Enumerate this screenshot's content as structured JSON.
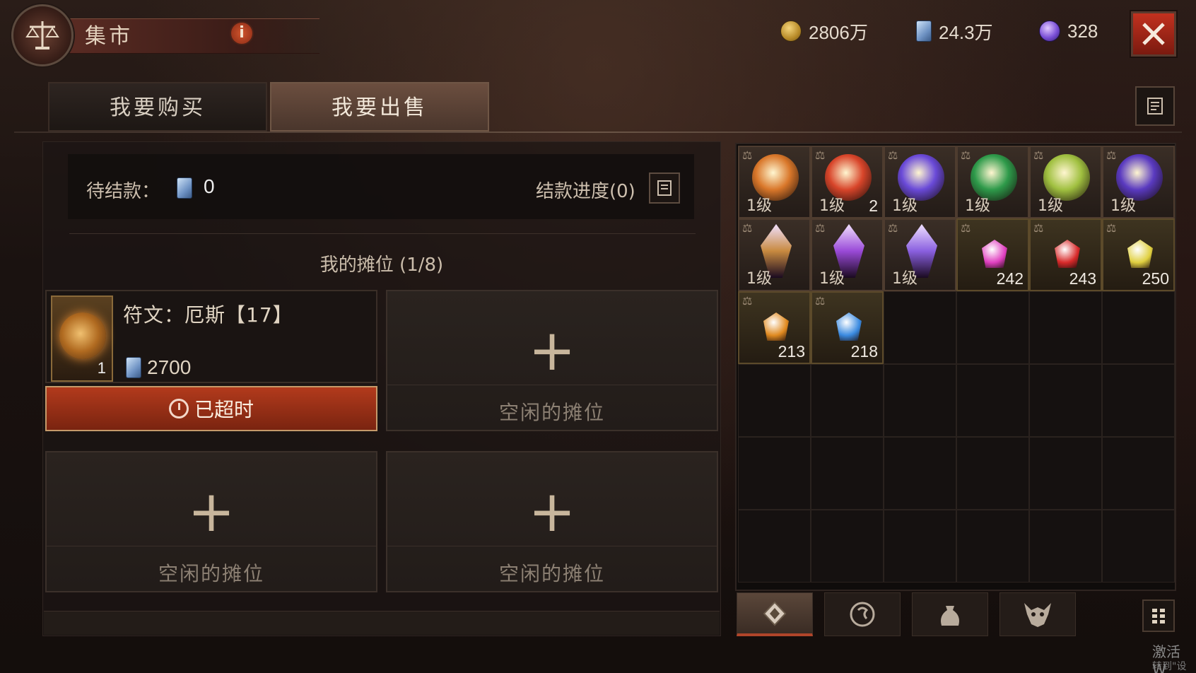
{
  "header": {
    "title": "集市",
    "info_label": "i",
    "currencies": [
      {
        "icon": "gold-coin-icon",
        "value": "2806万"
      },
      {
        "icon": "platinum-card-icon",
        "value": "24.3万"
      },
      {
        "icon": "purple-orb-icon",
        "value": "328"
      }
    ]
  },
  "tabs": [
    {
      "label": "我要购买",
      "active": false
    },
    {
      "label": "我要出售",
      "active": true
    }
  ],
  "pending": {
    "label": "待结款：",
    "value": "0",
    "progress_label": "结款进度(0)"
  },
  "stall": {
    "title": "我的摊位 (1/8)",
    "listed": {
      "name": "符文：厄斯【17】",
      "quantity": "1",
      "price": "2700",
      "status": "已超时"
    },
    "empty_label": "空闲的摊位"
  },
  "inventory": {
    "row1": [
      {
        "level": "1级",
        "qty": "",
        "color": "#d9772a"
      },
      {
        "level": "1级",
        "qty": "2",
        "color": "#d8452a"
      },
      {
        "level": "1级",
        "qty": "",
        "color": "#6a4ad8"
      },
      {
        "level": "1级",
        "qty": "",
        "color": "#2e9a4a"
      },
      {
        "level": "1级",
        "qty": "",
        "color": "#a0c040"
      },
      {
        "level": "1级",
        "qty": "",
        "color": "#5a3ac0"
      }
    ],
    "row2": [
      {
        "level": "1级",
        "qty": "",
        "color": "#c88a40"
      },
      {
        "level": "1级",
        "qty": "",
        "color": "#9a4ad8"
      },
      {
        "level": "1级",
        "qty": "",
        "color": "#8a60e0"
      },
      {
        "level": "",
        "qty": "242",
        "color": "#e040c0"
      },
      {
        "level": "",
        "qty": "243",
        "color": "#d82a2a"
      },
      {
        "level": "",
        "qty": "250",
        "color": "#e0d040"
      }
    ],
    "row3": [
      {
        "level": "",
        "qty": "213",
        "color": "#e08a20"
      },
      {
        "level": "",
        "qty": "218",
        "color": "#3a8ae0"
      }
    ]
  },
  "categories": [
    "rune-category-icon",
    "gem-category-icon",
    "bag-category-icon",
    "demon-category-icon"
  ],
  "watermark": {
    "line1": "激活 W",
    "line2": "转到\"设置"
  }
}
